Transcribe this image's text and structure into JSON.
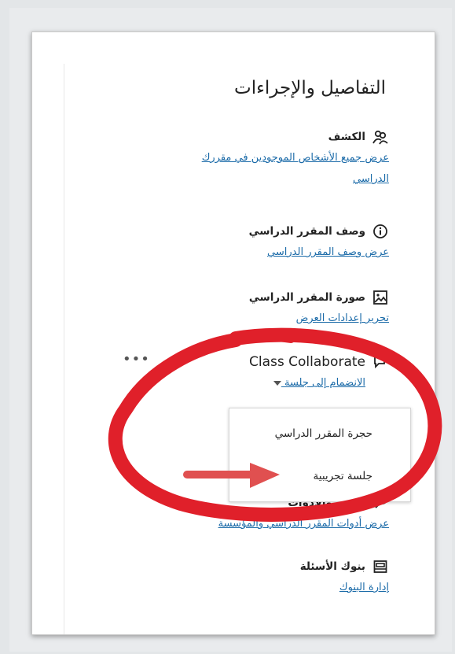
{
  "panel": {
    "title": "التفاصيل والإجراءات",
    "roster": {
      "heading": "الكشف",
      "link": "عرض جميع الأشخاص الموجودين في مقررك",
      "link_line2": "الدراسي"
    },
    "description": {
      "heading": "وصف المقرر الدراسي",
      "link": "عرض وصف المقرر الدراسي"
    },
    "image": {
      "heading": "صورة المقرر الدراسي",
      "link": "تحرير إعدادات العرض"
    },
    "collaborate": {
      "heading": "Class Collaborate",
      "join_link": "الانضمام إلى جلسة",
      "more": "•••"
    },
    "tools": {
      "heading": "الكتب والأدوات",
      "link": "عرض أدوات المقرر الدراسي والمؤسسة"
    },
    "banks": {
      "heading": "بنوك الأسئلة",
      "link": "إدارة البنوك"
    }
  },
  "dropdown": {
    "items": [
      "حجرة المقرر الدراسي",
      "جلسة تجريبية"
    ]
  },
  "annotation": {
    "circle_color": "#e0202a",
    "arrow_color": "#e05050"
  }
}
